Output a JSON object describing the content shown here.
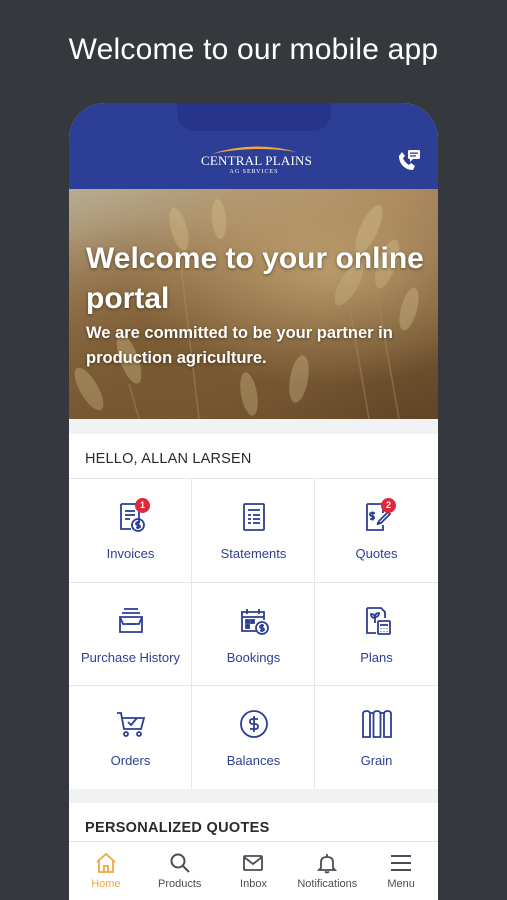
{
  "promo": {
    "title": "Welcome to our mobile app"
  },
  "header": {
    "logo_main": "CENTRAL PLAINS",
    "logo_sub": "AG SERVICES",
    "contact_icon": "phone-message-icon",
    "colors": {
      "bar": "#2d3e96",
      "accent": "#f2a73b"
    }
  },
  "hero": {
    "title": "Welcome to your online portal",
    "subtitle": "We are committed to be your partner in production agriculture."
  },
  "greeting": "HELLO, ALLAN LARSEN",
  "tiles": [
    {
      "label": "Invoices",
      "icon": "invoice-icon",
      "badge": "1"
    },
    {
      "label": "Statements",
      "icon": "statement-icon"
    },
    {
      "label": "Quotes",
      "icon": "quote-icon",
      "badge": "2"
    },
    {
      "label": "Purchase History",
      "icon": "purchase-history-icon"
    },
    {
      "label": "Bookings",
      "icon": "bookings-icon"
    },
    {
      "label": "Plans",
      "icon": "plans-icon"
    },
    {
      "label": "Orders",
      "icon": "cart-icon"
    },
    {
      "label": "Balances",
      "icon": "balance-icon"
    },
    {
      "label": "Grain",
      "icon": "grain-bin-icon"
    }
  ],
  "quotes_section": {
    "title": "PERSONALIZED QUOTES"
  },
  "tabbar": [
    {
      "label": "Home",
      "icon": "home-icon",
      "active": true
    },
    {
      "label": "Products",
      "icon": "search-icon"
    },
    {
      "label": "Inbox",
      "icon": "mail-icon"
    },
    {
      "label": "Notifications",
      "icon": "bell-icon"
    },
    {
      "label": "Menu",
      "icon": "hamburger-icon"
    }
  ]
}
